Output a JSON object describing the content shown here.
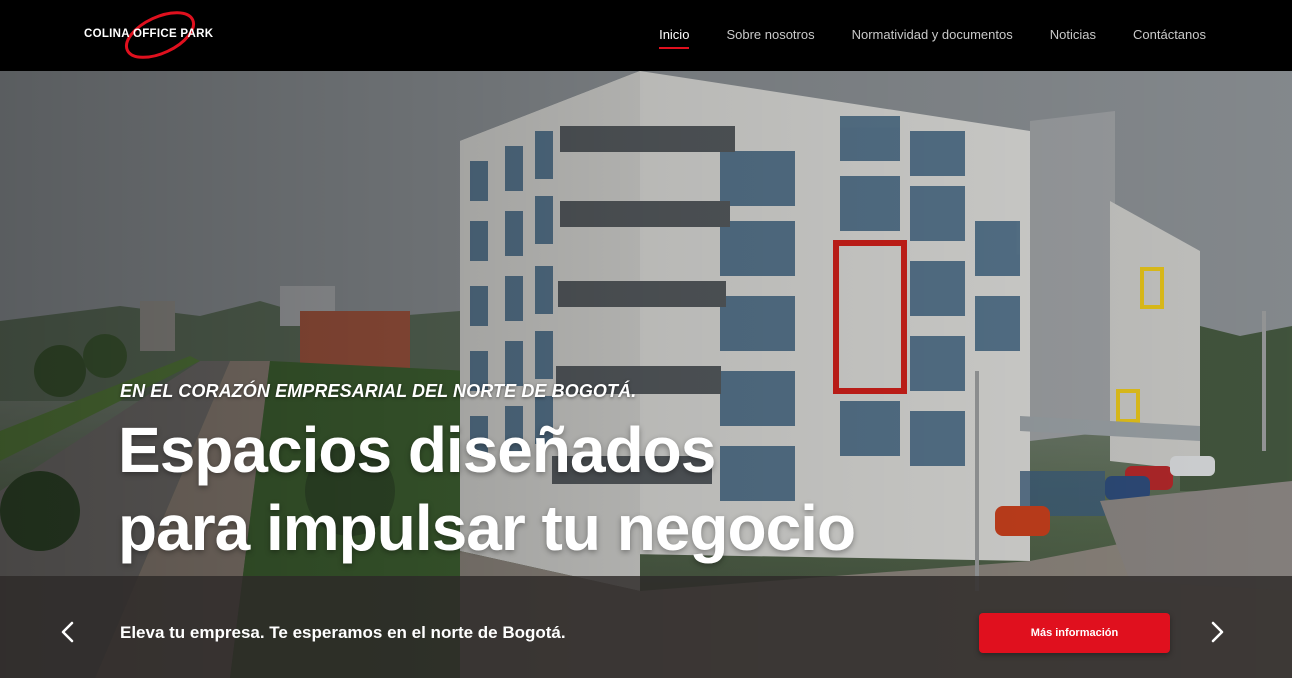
{
  "brand": {
    "logo_text": "COLINA OFFICE PARK",
    "accent": "#e0101e"
  },
  "nav": {
    "items": [
      {
        "label": "Inicio",
        "active": true
      },
      {
        "label": "Sobre nosotros",
        "active": false
      },
      {
        "label": "Normatividad y documentos",
        "active": false
      },
      {
        "label": "Noticias",
        "active": false
      },
      {
        "label": "Contáctanos",
        "active": false
      }
    ]
  },
  "hero": {
    "eyebrow": "EN EL CORAZÓN EMPRESARIAL DEL NORTE DE BOGOTÁ.",
    "headline_line1": "Espacios diseñados",
    "headline_line2": "para impulsar tu negocio"
  },
  "bar": {
    "tagline": "Eleva tu empresa. Te esperamos en el norte de Bogotá.",
    "cta_label": "Más información",
    "prev_icon": "chevron-left-icon",
    "next_icon": "chevron-right-icon"
  }
}
